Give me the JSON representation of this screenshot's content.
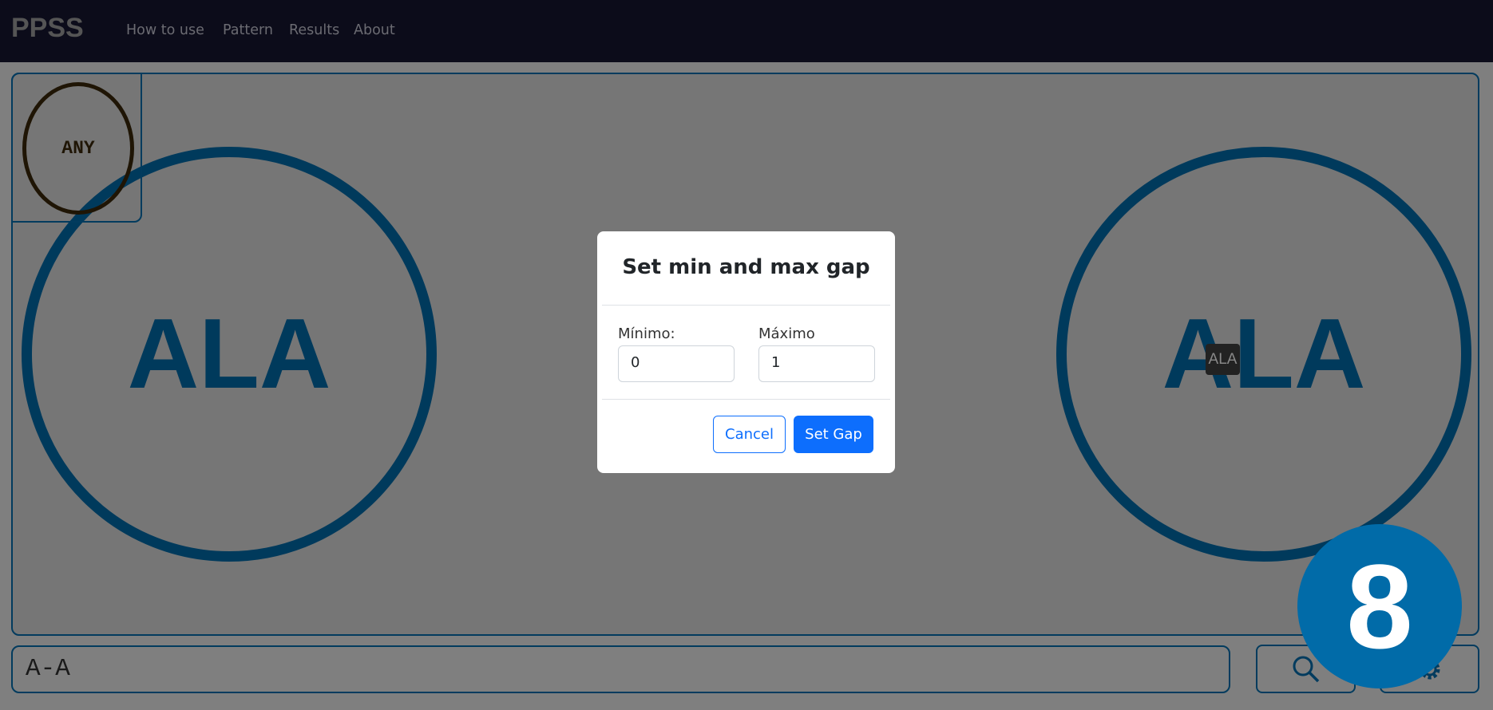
{
  "navbar": {
    "brand": "PPSS",
    "links": [
      "How to use",
      "Pattern",
      "Results",
      "About"
    ]
  },
  "canvas": {
    "any_node": "ANY",
    "nodes": [
      "ALA",
      "ALA"
    ],
    "tooltip": "ALA"
  },
  "modal": {
    "title": "Set min and max gap",
    "min_label": "Mínimo:",
    "min_value": "0",
    "max_label": "Máximo",
    "max_value": "1",
    "cancel": "Cancel",
    "submit": "Set Gap"
  },
  "pattern_input": {
    "value": "A-A"
  },
  "toolbar": {
    "search_icon": "search-icon",
    "settings_icon": "gear-icon"
  },
  "badge": {
    "value": "8"
  },
  "colors": {
    "navbar": "#0c0c1a",
    "node": "#003a5c",
    "primary": "#0d6efd",
    "badge": "#016ba8"
  }
}
